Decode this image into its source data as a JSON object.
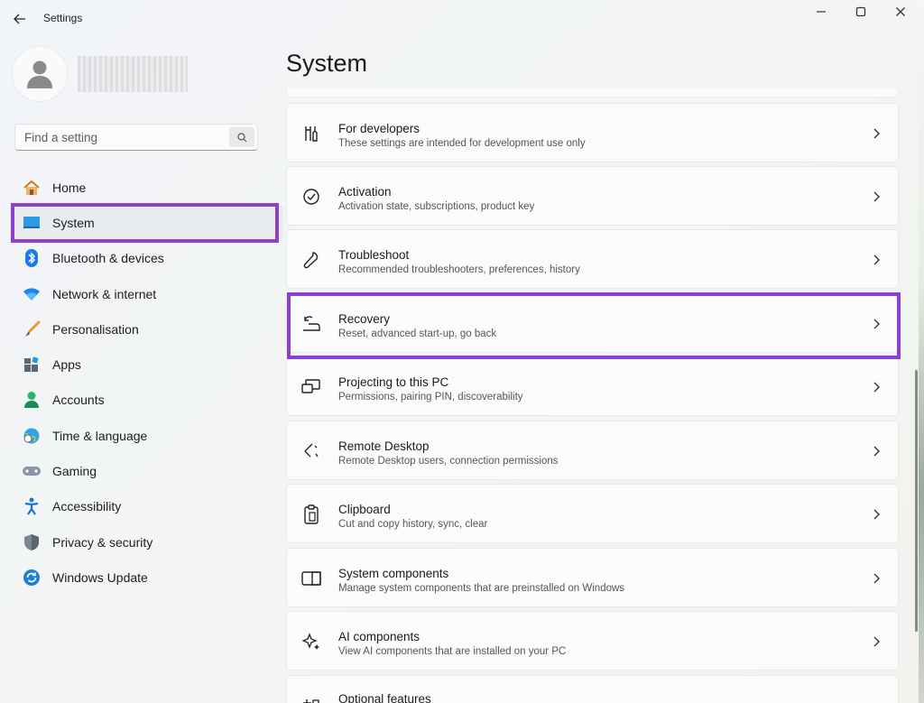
{
  "window": {
    "title": "Settings"
  },
  "search": {
    "placeholder": "Find a setting"
  },
  "nav": [
    {
      "label": "Home",
      "icon": "home-icon"
    },
    {
      "label": "System",
      "icon": "monitor-icon",
      "active": true
    },
    {
      "label": "Bluetooth & devices",
      "icon": "bluetooth-icon"
    },
    {
      "label": "Network & internet",
      "icon": "wifi-icon"
    },
    {
      "label": "Personalisation",
      "icon": "brush-icon"
    },
    {
      "label": "Apps",
      "icon": "apps-icon"
    },
    {
      "label": "Accounts",
      "icon": "accounts-icon"
    },
    {
      "label": "Time & language",
      "icon": "globe-clock-icon"
    },
    {
      "label": "Gaming",
      "icon": "gamepad-icon"
    },
    {
      "label": "Accessibility",
      "icon": "accessibility-icon"
    },
    {
      "label": "Privacy & security",
      "icon": "shield-icon"
    },
    {
      "label": "Windows Update",
      "icon": "update-icon"
    }
  ],
  "page": {
    "title": "System"
  },
  "cards": [
    {
      "title": "For developers",
      "subtitle": "These settings are intended for development use only",
      "icon": "developer-tools-icon"
    },
    {
      "title": "Activation",
      "subtitle": "Activation state, subscriptions, product key",
      "icon": "check-circle-icon"
    },
    {
      "title": "Troubleshoot",
      "subtitle": "Recommended troubleshooters, preferences, history",
      "icon": "wrench-icon"
    },
    {
      "title": "Recovery",
      "subtitle": "Reset, advanced start-up, go back",
      "icon": "recovery-icon"
    },
    {
      "title": "Projecting to this PC",
      "subtitle": "Permissions, pairing PIN, discoverability",
      "icon": "projector-icon"
    },
    {
      "title": "Remote Desktop",
      "subtitle": "Remote Desktop users, connection permissions",
      "icon": "remote-desktop-icon"
    },
    {
      "title": "Clipboard",
      "subtitle": "Cut and copy history, sync, clear",
      "icon": "clipboard-icon"
    },
    {
      "title": "System components",
      "subtitle": "Manage system components that are preinstalled on Windows",
      "icon": "components-icon"
    },
    {
      "title": "AI components",
      "subtitle": "View AI components that are installed on your PC",
      "icon": "ai-sparkle-icon"
    },
    {
      "title": "Optional features",
      "subtitle": "",
      "icon": "add-features-icon"
    }
  ],
  "colors": {
    "highlight": "#8e3fd0",
    "accent": "#0067c0"
  }
}
